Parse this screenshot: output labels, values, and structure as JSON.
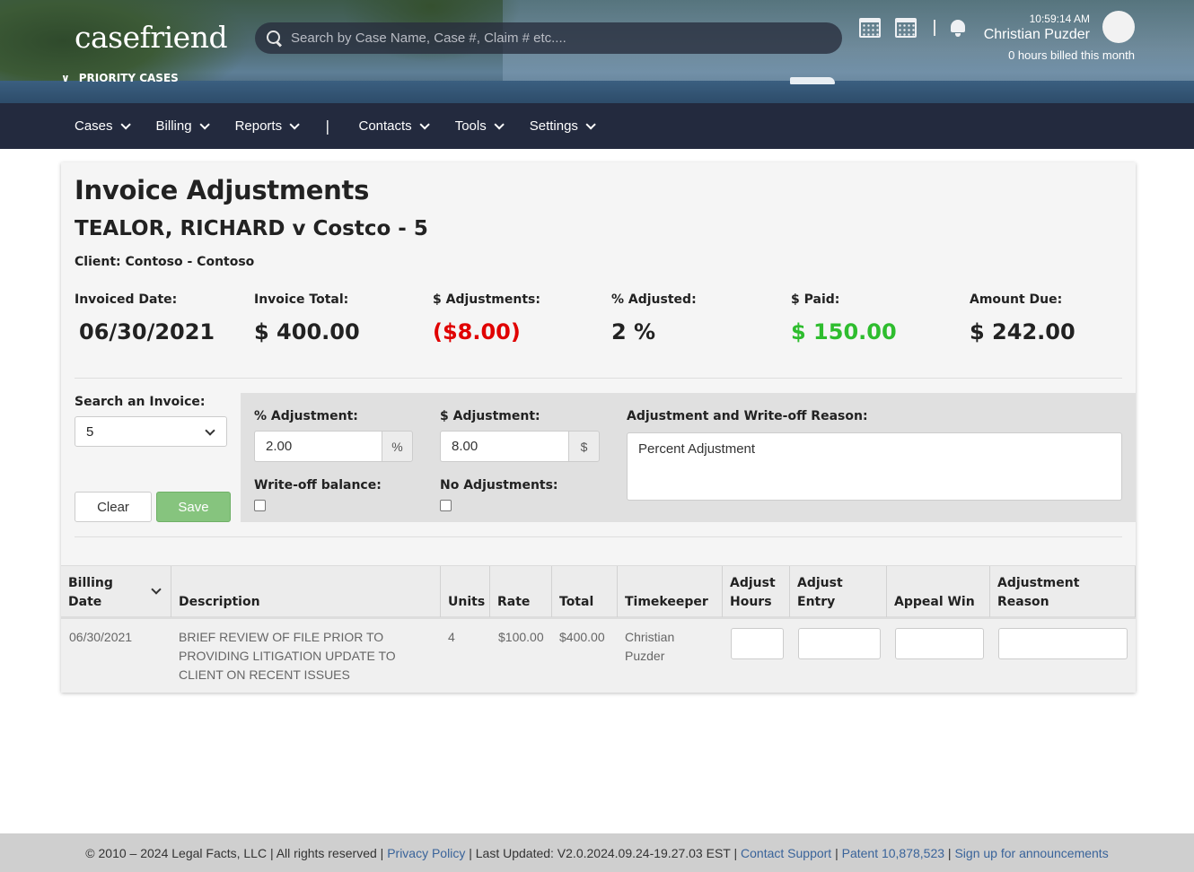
{
  "header": {
    "logo": "casefriend",
    "priority_label": "PRIORITY CASES",
    "search_placeholder": "Search by Case Name, Case #, Claim # etc....",
    "time": "10:59:14 AM",
    "user_name": "Christian Puzder",
    "billed_text": "0 hours billed this month",
    "icons": [
      "calendar-icon",
      "team-calendar-icon",
      "bell-icon",
      "avatar"
    ]
  },
  "nav": {
    "items": [
      {
        "label": "Cases"
      },
      {
        "label": "Billing"
      },
      {
        "label": "Reports"
      },
      {
        "label": "Contacts"
      },
      {
        "label": "Tools"
      },
      {
        "label": "Settings"
      }
    ],
    "separator": "|"
  },
  "page": {
    "title": "Invoice Adjustments",
    "case_title": "TEALOR, RICHARD v Costco - 5",
    "client": "Client: Contoso - Contoso"
  },
  "stats": [
    {
      "label": "Invoiced Date:",
      "value": "06/30/2021",
      "color": "#222222"
    },
    {
      "label": "Invoice Total:",
      "value": "$ 400.00",
      "color": "#222222"
    },
    {
      "label": "$ Adjustments:",
      "value": "($8.00)",
      "color": "#e00000"
    },
    {
      "label": "% Adjusted:",
      "value": "2 %",
      "color": "#222222"
    },
    {
      "label": "$ Paid:",
      "value": "$ 150.00",
      "color": "#2ebd2e"
    },
    {
      "label": "Amount Due:",
      "value": "$ 242.00",
      "color": "#222222"
    }
  ],
  "form": {
    "search_invoice_label": "Search an Invoice:",
    "search_invoice_value": "5",
    "clear_label": "Clear",
    "save_label": "Save",
    "pct_adj_label": "% Adjustment:",
    "pct_adj_value": "2.00",
    "pct_addon": "%",
    "dollar_adj_label": "$ Adjustment:",
    "dollar_adj_value": "8.00",
    "dollar_addon": "$",
    "reason_label": "Adjustment and Write-off Reason:",
    "reason_value": "Percent Adjustment",
    "writeoff_label": "Write-off balance:",
    "no_adj_label": "No Adjustments:"
  },
  "table": {
    "headers": {
      "billing_date_1": "Billing",
      "billing_date_2": "Date",
      "description": "Description",
      "units": "Units",
      "rate": "Rate",
      "total": "Total",
      "timekeeper": "Timekeeper",
      "adjust_hours_1": "Adjust",
      "adjust_hours_2": "Hours",
      "adjust_entry_1": "Adjust",
      "adjust_entry_2": "Entry",
      "appeal_win": "Appeal Win",
      "adjustment_reason_1": "Adjustment",
      "adjustment_reason_2": "Reason"
    },
    "rows": [
      {
        "billing_date": "06/30/2021",
        "description_1": "BRIEF REVIEW OF FILE PRIOR TO",
        "description_2": "PROVIDING LITIGATION UPDATE TO",
        "description_3": "CLIENT ON RECENT ISSUES",
        "units": "4",
        "rate": "$100.00",
        "total": "$400.00",
        "timekeeper_1": "Christian",
        "timekeeper_2": "Puzder"
      }
    ]
  },
  "footer": {
    "copyright": "© 2010 – 2024 Legal Facts, LLC | All rights reserved | ",
    "privacy": "Privacy Policy",
    "updated": " | Last Updated: V2.0.2024.09.24-19.27.03 EST | ",
    "support": "Contact Support",
    "sep1": " | ",
    "patent": "Patent 10,878,523",
    "sep2": " | ",
    "signup": "Sign up for announcements"
  }
}
